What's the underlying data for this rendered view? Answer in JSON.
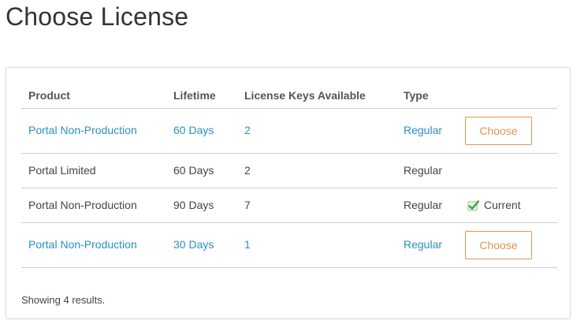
{
  "page": {
    "title": "Choose License"
  },
  "table": {
    "headers": [
      "Product",
      "Lifetime",
      "License Keys Available",
      "Type"
    ],
    "rows": [
      {
        "product": "Portal Non-Production",
        "lifetime": "60 Days",
        "keys": "2",
        "type": "Regular",
        "action": "Choose"
      },
      {
        "product": "Portal Limited",
        "lifetime": "60 Days",
        "keys": "2",
        "type": "Regular"
      },
      {
        "product": "Portal Non-Production",
        "lifetime": "90 Days",
        "keys": "7",
        "type": "Regular",
        "status": "Current"
      },
      {
        "product": "Portal Non-Production",
        "lifetime": "30 Days",
        "keys": "1",
        "type": "Regular",
        "action": "Choose"
      }
    ]
  },
  "footer": {
    "summary": "Showing 4 results."
  },
  "colors": {
    "link": "#2a8fc6",
    "button": "#e39452",
    "text": "#444444",
    "check": "#3a9a3a"
  },
  "icons": {
    "current_status": "check-icon"
  }
}
